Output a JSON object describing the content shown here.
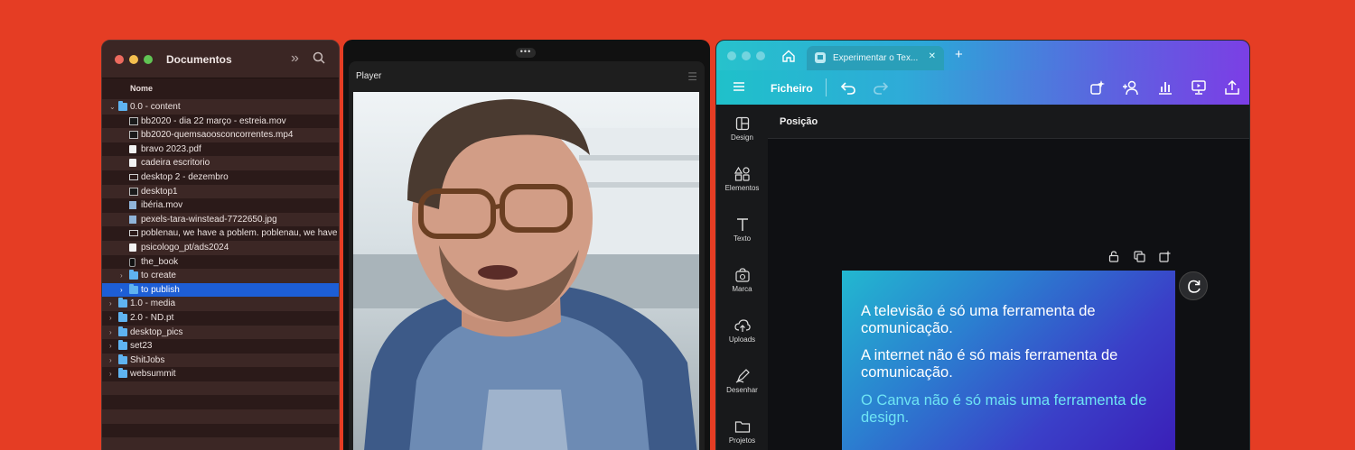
{
  "finder": {
    "title": "Documentos",
    "column_header": "Nome",
    "items": [
      {
        "name": "0.0 - content",
        "type": "folder",
        "level": 0,
        "expanded": true
      },
      {
        "name": "bb2020 - dia 22 março - estreia.mov",
        "type": "movie",
        "level": 1
      },
      {
        "name": "bb2020-quemsaoosconcorrentes.mp4",
        "type": "movie",
        "level": 1
      },
      {
        "name": "bravo 2023.pdf",
        "type": "doc",
        "level": 1
      },
      {
        "name": "cadeira escritorio",
        "type": "doc",
        "level": 1
      },
      {
        "name": "desktop 2 - dezembro",
        "type": "screen",
        "level": 1
      },
      {
        "name": "desktop1",
        "type": "movie",
        "level": 1
      },
      {
        "name": "ibéria.mov",
        "type": "jpg",
        "level": 1
      },
      {
        "name": "pexels-tara-winstead-7722650.jpg",
        "type": "jpg",
        "level": 1
      },
      {
        "name": "poblenau, we have a poblem. poblenau, we have",
        "type": "screen",
        "level": 1
      },
      {
        "name": "psicologo_pt/ads2024",
        "type": "doc",
        "level": 1
      },
      {
        "name": "the_book",
        "type": "phone",
        "level": 1
      },
      {
        "name": "to create",
        "type": "folder",
        "level": 1,
        "expanded": false
      },
      {
        "name": "to publish",
        "type": "folder",
        "level": 1,
        "expanded": false,
        "selected": true
      },
      {
        "name": "1.0 - media",
        "type": "folder",
        "level": 0,
        "expanded": false
      },
      {
        "name": "2.0 - ND.pt",
        "type": "folder",
        "level": 0,
        "expanded": false
      },
      {
        "name": "desktop_pics",
        "type": "folder",
        "level": 0,
        "expanded": false
      },
      {
        "name": "set23",
        "type": "folder",
        "level": 0,
        "expanded": false
      },
      {
        "name": "ShitJobs",
        "type": "folder",
        "level": 0,
        "expanded": false
      },
      {
        "name": "websummit",
        "type": "folder",
        "level": 0,
        "expanded": false
      },
      {
        "name": "",
        "type": "empty"
      },
      {
        "name": "",
        "type": "empty"
      },
      {
        "name": "",
        "type": "empty"
      },
      {
        "name": "",
        "type": "empty"
      },
      {
        "name": "",
        "type": "empty"
      }
    ]
  },
  "player": {
    "title": "Player",
    "dots": "•••"
  },
  "canva": {
    "tab_label": "Experimentar o Tex...",
    "toolbar": {
      "file_label": "Ficheiro"
    },
    "sidebar": [
      {
        "label": "Design",
        "icon": "layout-icon"
      },
      {
        "label": "Elementos",
        "icon": "shapes-icon"
      },
      {
        "label": "Texto",
        "icon": "text-icon"
      },
      {
        "label": "Marca",
        "icon": "brand-icon"
      },
      {
        "label": "Uploads",
        "icon": "cloud-upload-icon"
      },
      {
        "label": "Desenhar",
        "icon": "draw-icon"
      },
      {
        "label": "Projetos",
        "icon": "folder-icon"
      }
    ],
    "panel_title": "Posição",
    "card": {
      "line1": "A televisão é só uma ferramenta de comunicação.",
      "line2": "A internet não é só mais ferramenta de comunicação.",
      "line3": "O Canva não é só mais uma ferramenta de design."
    }
  },
  "colors": {
    "background": "#e53d24",
    "finder_selected": "#1d5ed6",
    "canva_accent_start": "#1fc1ca",
    "canva_accent_end": "#7c3de6",
    "card_highlight_text": "#6ee4f4"
  }
}
